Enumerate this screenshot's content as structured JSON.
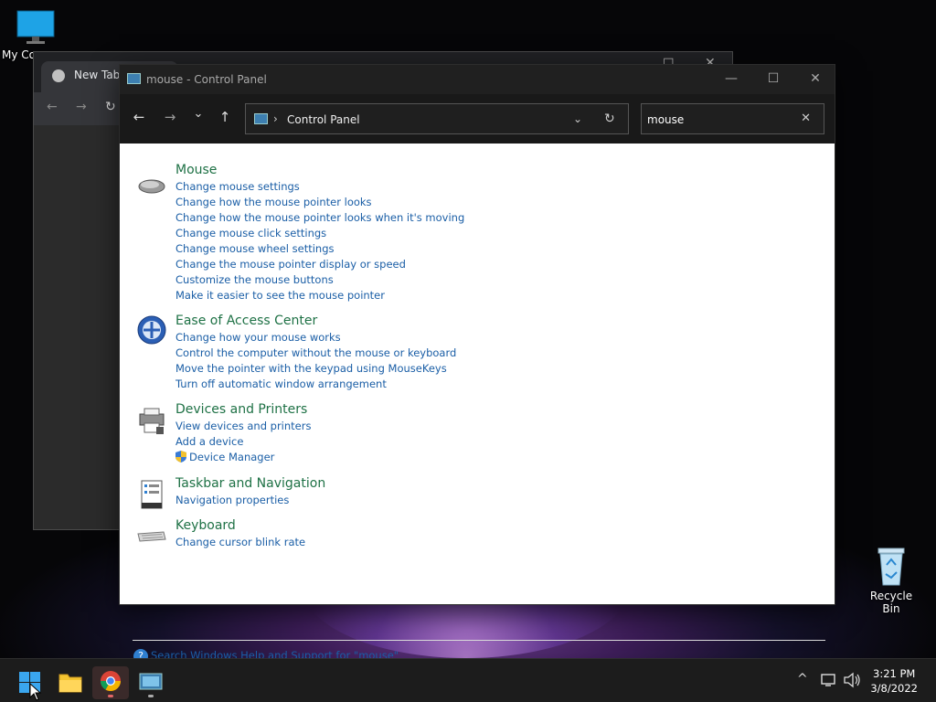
{
  "desktop": {
    "my_computer_label": "My Co",
    "recycle_bin_label": "Recycle Bin"
  },
  "chrome": {
    "tab_title": "New Tab",
    "minimize": "⌄",
    "maximize": "☐",
    "close": "✕"
  },
  "control_panel": {
    "window_title": "mouse - Control Panel",
    "minimize": "—",
    "maximize": "☐",
    "close": "✕",
    "nav": {
      "back": "←",
      "forward": "→",
      "recent": "⌄",
      "up": "↑"
    },
    "address": {
      "separator": "›",
      "crumb": "Control Panel",
      "dropdown": "⌄",
      "refresh": "↻"
    },
    "search": {
      "value": "mouse",
      "clear": "✕"
    },
    "groups": [
      {
        "title": "Mouse",
        "icon": "mouse-icon",
        "links": [
          "Change mouse settings",
          "Change how the mouse pointer looks",
          "Change how the mouse pointer looks when it's moving",
          "Change mouse click settings",
          "Change mouse wheel settings",
          "Change the mouse pointer display or speed",
          "Customize the mouse buttons",
          "Make it easier to see the mouse pointer"
        ]
      },
      {
        "title": "Ease of Access Center",
        "icon": "ease-of-access-icon",
        "links": [
          "Change how your mouse works",
          "Control the computer without the mouse or keyboard",
          "Move the pointer with the keypad using MouseKeys",
          "Turn off automatic window arrangement"
        ]
      },
      {
        "title": "Devices and Printers",
        "icon": "printer-icon",
        "links": [
          "View devices and printers",
          "Add a device",
          "Device Manager"
        ]
      },
      {
        "title": "Taskbar and Navigation",
        "icon": "taskbar-icon",
        "links": [
          "Navigation properties"
        ]
      },
      {
        "title": "Keyboard",
        "icon": "keyboard-icon",
        "links": [
          "Change cursor blink rate"
        ]
      }
    ],
    "help_icon": "?",
    "help_link": "Search Windows Help and Support for \"mouse\""
  },
  "taskbar": {
    "tray_chevron": "^",
    "time": "3:21 PM",
    "date": "3/8/2022"
  },
  "colors": {
    "link": "#1a5ea6",
    "group_title": "#1e7145",
    "title_bar": "#202020",
    "nav_bar": "#191919"
  }
}
